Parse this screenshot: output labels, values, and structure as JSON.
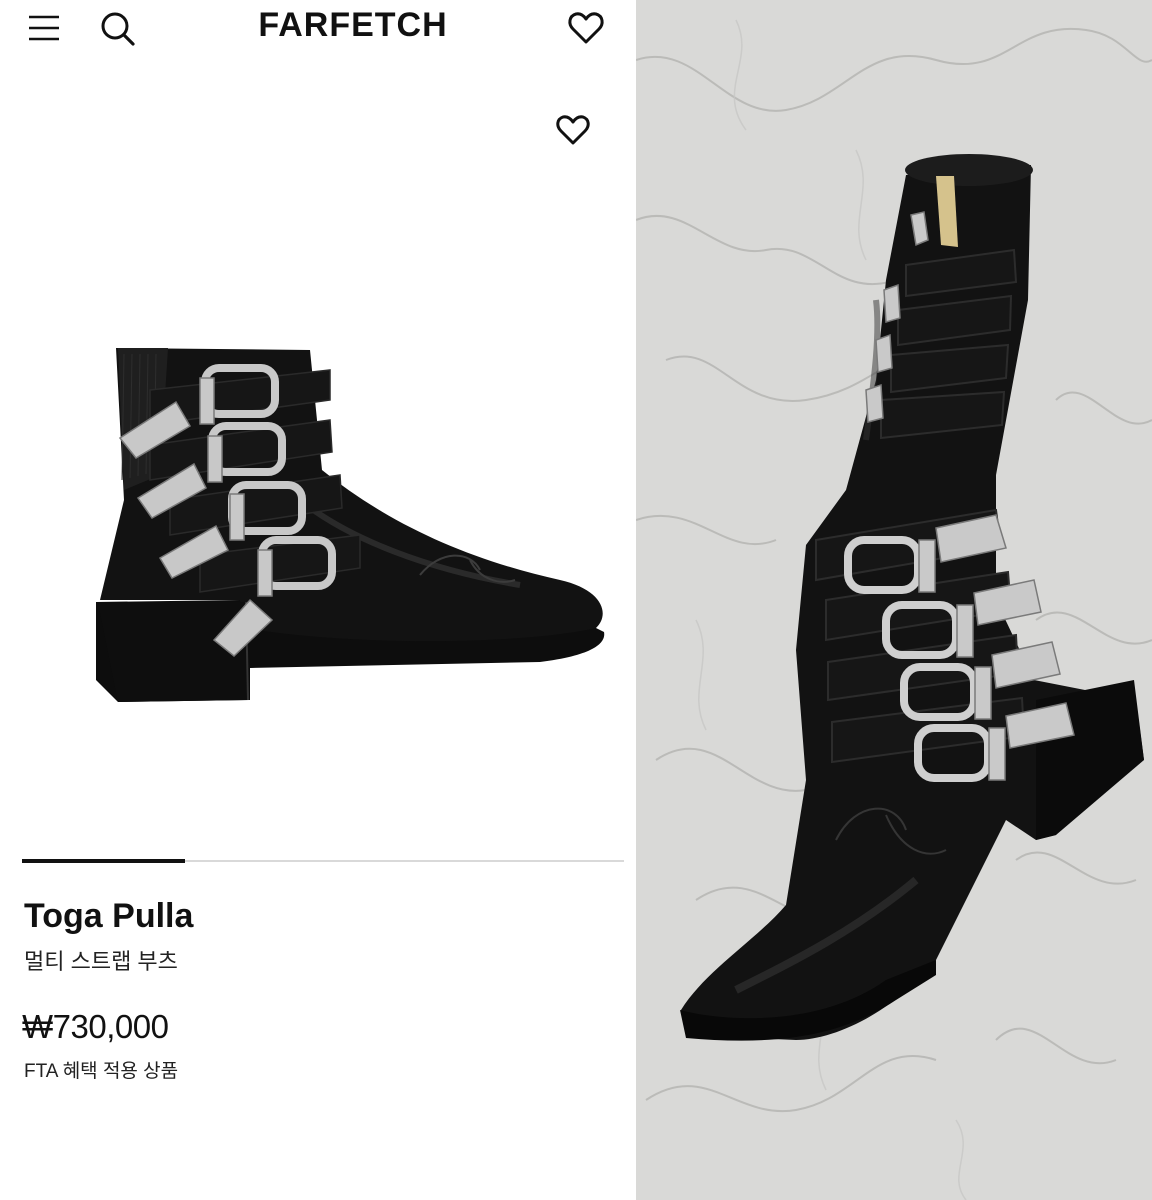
{
  "header": {
    "logo": "FARFETCH",
    "icons": [
      "menu-icon",
      "search-icon",
      "heart-outline-icon"
    ]
  },
  "product": {
    "brand": "Toga Pulla",
    "description": "멀티 스트랩 부츠",
    "price": "₩730,000",
    "note": "FTA 혜택 적용 상품",
    "gallery_progress": 0.27
  },
  "colors": {
    "text": "#111111",
    "progress_fill": "#111111",
    "progress_track": "#d9d9d9",
    "boot_black": "#121212",
    "buckle_silver": "#c8c8c8",
    "marble": "#d9d9d7"
  }
}
